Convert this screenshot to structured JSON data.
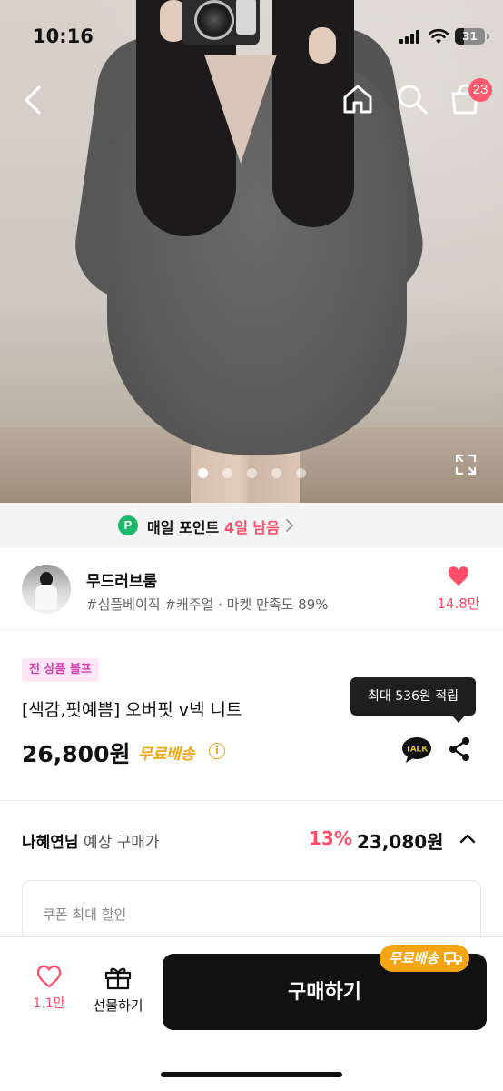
{
  "status_bar": {
    "time": "10:16",
    "battery": "31",
    "battery_level": 0.31
  },
  "gallery": {
    "total_images": 5,
    "active_index": 0
  },
  "header": {
    "cart_count": "23"
  },
  "point_banner": {
    "icon": "P",
    "text": "매일 포인트",
    "days_left": "4일 남음"
  },
  "store": {
    "name": "무드러브룸",
    "tags": "#심플베이직 #캐주얼 · 마켓 만족도 89%",
    "likes": "14.8만"
  },
  "product": {
    "promo_badge": "전 상품 블프",
    "title": "[색감,핏예쁨] 오버핏 v넥 니트",
    "price": "26,800원",
    "free_shipping": "무료배송",
    "info_icon": "i",
    "talk_label": "TALK",
    "tooltip": "최대 536원 적립"
  },
  "expected": {
    "user": "나혜연님",
    "label": "예상 구매가",
    "discount": "13%",
    "final_price": "23,080원"
  },
  "coupon": {
    "label": "쿠폰 최대 할인"
  },
  "bottom_bar": {
    "wish_count": "1.1만",
    "gift_label": "선물하기",
    "buy_label": "구매하기",
    "free_ship_pill": "무료배송"
  },
  "colors": {
    "accent_pink": "#ff4d6a",
    "ship_orange": "#f5a414",
    "point_green": "#1db86b",
    "promo_magenta": "#d63ab0"
  }
}
